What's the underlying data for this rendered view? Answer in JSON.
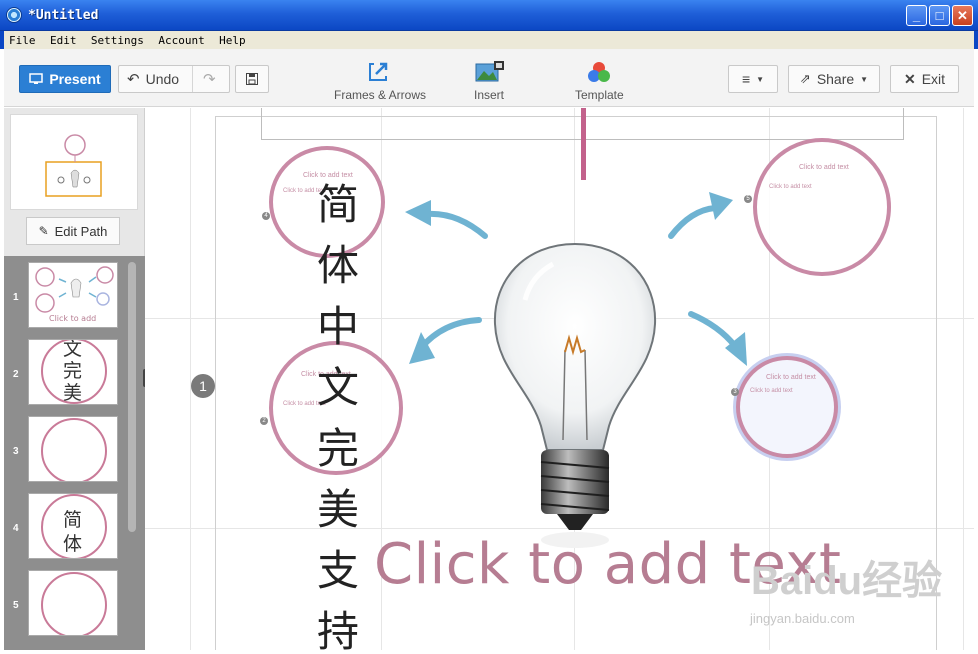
{
  "window": {
    "title": "*Untitled",
    "controls": {
      "minimize": "_",
      "maximize": "□",
      "close": "✕"
    }
  },
  "menu": [
    "File",
    "Edit",
    "Settings",
    "Account",
    "Help"
  ],
  "toolbar": {
    "present_label": "Present",
    "undo_label": "Undo",
    "frames_label": "Frames & Arrows",
    "insert_label": "Insert",
    "template_label": "Template",
    "share_label": "Share",
    "exit_label": "Exit"
  },
  "left_panel": {
    "edit_path_label": "Edit Path",
    "slides": [
      {
        "number": "1",
        "thumb_text": ""
      },
      {
        "number": "2",
        "thumb_text": "文完美"
      },
      {
        "number": "3",
        "thumb_text": ""
      },
      {
        "number": "4",
        "thumb_text": "简体"
      },
      {
        "number": "5",
        "thumb_text": ""
      }
    ]
  },
  "canvas": {
    "step_badge": "1",
    "vertical_text": "简体中文完美支持",
    "big_placeholder": "Click to add text",
    "bubble_hint": "Click to add text",
    "bubble_subhint": "Click to add text",
    "pins": [
      "4",
      "2",
      "5",
      "3"
    ]
  },
  "watermark": {
    "brand": "Baidu经验",
    "url": "jingyan.baidu.com"
  },
  "colors": {
    "present": "#2b7fd4",
    "bubble_border": "#c98aa6",
    "arrow": "#6fb3d2",
    "placeholder_text": "#b67d92"
  }
}
